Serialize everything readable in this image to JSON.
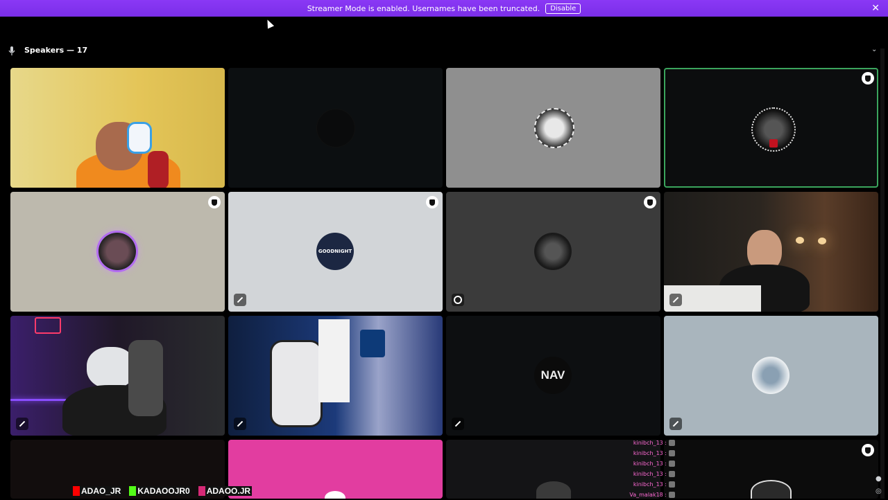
{
  "banner": {
    "message": "Streamer Mode is enabled. Usernames have been truncated.",
    "disable_label": "Disable",
    "close_glyph": "✕",
    "accent": "#8a38f5"
  },
  "speakers": {
    "label": "Speakers — 17",
    "collapse_glyph": "⌄"
  },
  "tiles": [
    {
      "kind": "video",
      "bg": "#e6cf6c"
    },
    {
      "kind": "avatar",
      "bg": "#0c0f11"
    },
    {
      "kind": "avatar",
      "bg": "#8f8f8f"
    },
    {
      "kind": "avatar",
      "bg": "#0c0d0e",
      "speaking": true
    },
    {
      "kind": "avatar",
      "bg": "#bdb9ad"
    },
    {
      "kind": "avatar",
      "bg": "#d2d5d8"
    },
    {
      "kind": "avatar",
      "bg": "#3b3b3b"
    },
    {
      "kind": "video",
      "bg": "#2a2520"
    },
    {
      "kind": "video",
      "bg": "#2b1e3a"
    },
    {
      "kind": "video",
      "bg": "#1b2a44"
    },
    {
      "kind": "avatar",
      "bg": "#0d0f11"
    },
    {
      "kind": "avatar",
      "bg": "#a9b5bd"
    },
    {
      "kind": "video",
      "bg": "#120d0d"
    },
    {
      "kind": "avatar",
      "bg": "#e23da0"
    },
    {
      "kind": "video",
      "bg": "#141416"
    },
    {
      "kind": "video",
      "bg": "#0c0c0c"
    }
  ],
  "chat_overlay": [
    {
      "user": "kinibch_13 :"
    },
    {
      "user": "kinibch_13 :"
    },
    {
      "user": "kinibch_13 :"
    },
    {
      "user": "kinibch_13 :"
    },
    {
      "user": "kinibch_13 :"
    },
    {
      "user": "Va_malak18 :"
    }
  ],
  "stream_socials": [
    {
      "platform": "youtube-icon",
      "handle": "ADAO_JR"
    },
    {
      "platform": "kick-icon",
      "handle": "KADAOOJR0"
    },
    {
      "platform": "instagram-icon",
      "handle": "ADAOO.JR"
    }
  ],
  "avatar_texts": {
    "goodnight": "GOODNIGHT",
    "nav": "NAV"
  }
}
